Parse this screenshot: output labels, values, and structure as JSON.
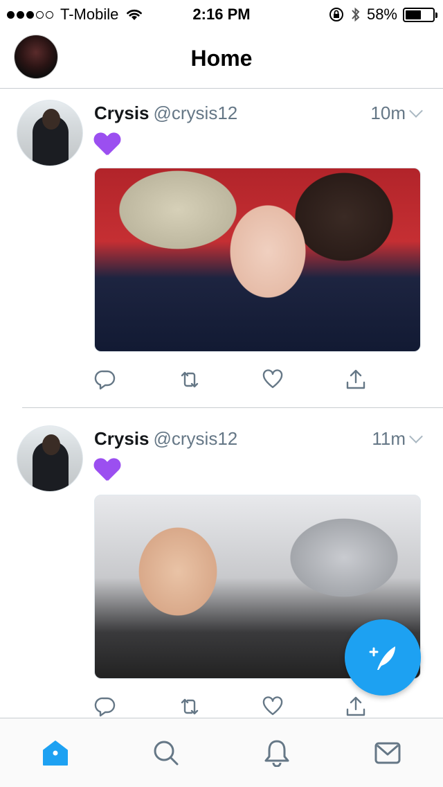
{
  "status_bar": {
    "carrier": "T-Mobile",
    "time": "2:16 PM",
    "battery": "58%",
    "battery_level": 0.58,
    "signal_bars_filled": 3,
    "signal_bars_total": 5
  },
  "header": {
    "title": "Home"
  },
  "tweets": [
    {
      "name": "Crysis",
      "handle": "@crysis12",
      "time": "10m",
      "text_emoji": "purple-heart"
    },
    {
      "name": "Crysis",
      "handle": "@crysis12",
      "time": "11m",
      "text_emoji": "purple-heart"
    }
  ],
  "actions": [
    "reply-icon",
    "retweet-icon",
    "like-icon",
    "share-icon"
  ],
  "tabbar": {
    "items": [
      "home-icon",
      "search-icon",
      "notifications-icon",
      "messages-icon"
    ],
    "active": "home-icon"
  },
  "colors": {
    "accent": "#1da1f2",
    "secondary_text": "#657786",
    "icon_gray": "#657786",
    "emoji_purple": "#9b4ff0"
  }
}
